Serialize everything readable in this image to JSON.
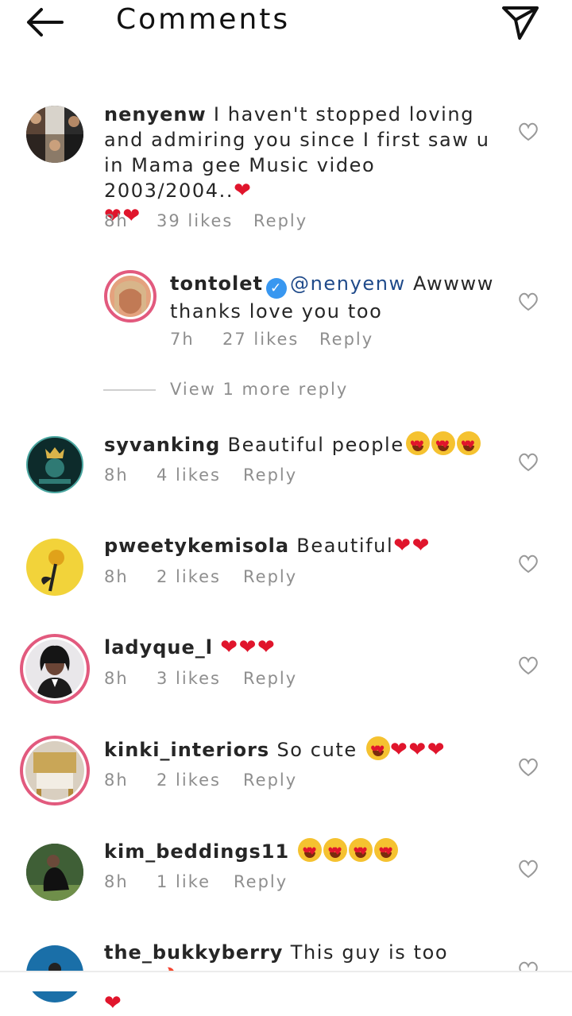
{
  "header": {
    "title": "Comments"
  },
  "comments": [
    {
      "user": "nenyenw",
      "text": "I haven't stopped loving and admiring you since I first saw u in Mama gee Music video 2003/2004..",
      "text_suffix": "❤",
      "line2": "❤❤",
      "time": "8h",
      "likes": "39 likes",
      "reply": "Reply"
    },
    {
      "user": "tontolet",
      "mention": "@nenyenw",
      "text": "Awwww",
      "line2": "thanks love you too",
      "time": "7h",
      "likes": "27 likes",
      "reply": "Reply"
    },
    {
      "user": "syvanking",
      "text": "Beautiful people",
      "time": "8h",
      "likes": "4 likes",
      "reply": "Reply"
    },
    {
      "user": "pweetykemisola",
      "text": "Beautiful",
      "time": "8h",
      "likes": "2 likes",
      "reply": "Reply"
    },
    {
      "user": "ladyque_l",
      "text": "",
      "time": "8h",
      "likes": "3 likes",
      "reply": "Reply"
    },
    {
      "user": "kinki_interiors",
      "text": "So cute",
      "time": "8h",
      "likes": "2 likes",
      "reply": "Reply"
    },
    {
      "user": "kim_beddings11",
      "text": "",
      "time": "8h",
      "likes": "1 like",
      "reply": "Reply"
    },
    {
      "user": "the_bukkyberry",
      "text": "This guy is too cute",
      "time": "",
      "likes": "",
      "reply": ""
    }
  ],
  "view_more": "View 1 more reply",
  "icons": {
    "back": "back-arrow-icon",
    "send": "paper-plane-icon",
    "like": "heart-outline-icon"
  },
  "colors": {
    "ring": "#e25a7e",
    "verified": "#3897f0",
    "mention": "#1f4a8a",
    "heart": "#e0152c"
  }
}
